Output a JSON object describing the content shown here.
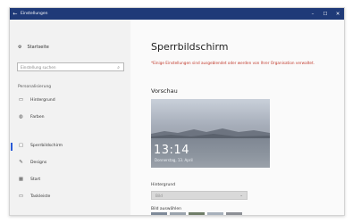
{
  "window": {
    "title": "Einstellungen",
    "back_icon": "arrow-left-icon",
    "controls": [
      "–",
      "☐",
      "✕"
    ]
  },
  "sidebar": {
    "home_label": "Startseite",
    "search_placeholder": "Einstellung suchen",
    "section_label": "Personalisierung",
    "items": [
      {
        "label": "Hintergrund",
        "icon": "image-icon"
      },
      {
        "label": "Farben",
        "icon": "palette-icon"
      },
      {
        "label": "Sperrbildschirm",
        "icon": "lock-screen-icon"
      },
      {
        "label": "Designs",
        "icon": "brush-icon"
      },
      {
        "label": "Start",
        "icon": "start-icon"
      },
      {
        "label": "Taskleiste",
        "icon": "taskbar-icon"
      }
    ],
    "active_index": 2
  },
  "main": {
    "title": "Sperrbildschirm",
    "warning": "*Einige Einstellungen sind ausgeblendet oder werden von Ihrer Organisation verwaltet.",
    "preview_label": "Vorschau",
    "clock": "13:14",
    "date": "Donnerstag, 13. April",
    "background_label": "Hintergrund",
    "background_value": "Bild",
    "choose_image_label": "Bild auswählen"
  },
  "colors": {
    "titlebar": "#1f3a78",
    "accent": "#2a5bd7",
    "warning": "#c0392b"
  }
}
